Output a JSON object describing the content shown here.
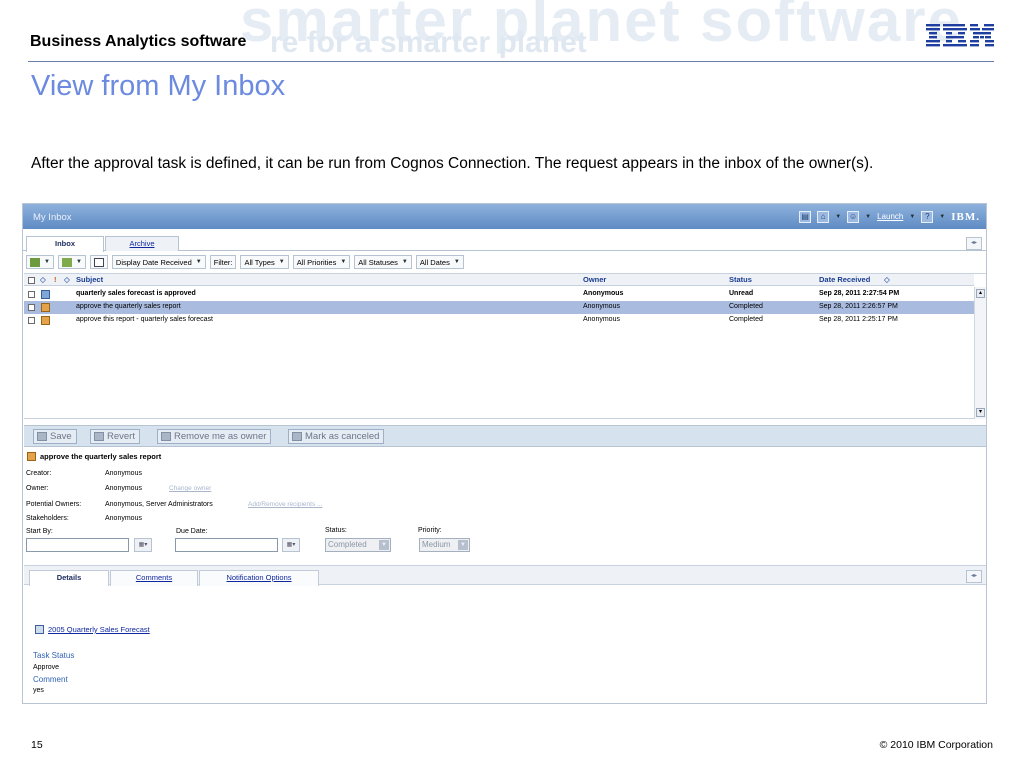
{
  "banner": {
    "brand_title": "Business Analytics software",
    "bg_watermark": "smarter planet software",
    "bg_watermark2": "re for a smarter planet",
    "logo_text": "IBM"
  },
  "slide": {
    "title": "View from My Inbox",
    "intro": "After the approval task is defined, it can be run from Cognos Connection.  The request appears in the inbox of the owner(s).",
    "page_number": "15",
    "copyright": "© 2010 IBM Corporation"
  },
  "app": {
    "title": "My Inbox",
    "topbar": {
      "launch_label": "Launch",
      "logo": "IBM."
    },
    "tabs": [
      {
        "label": "Inbox",
        "active": true
      },
      {
        "label": "Archive",
        "active": false
      }
    ],
    "toolbar": {
      "display_select": "Display Date Received",
      "filter_label": "Filter:",
      "types_select": "All Types",
      "priorities_select": "All Priorities",
      "statuses_select": "All Statuses",
      "dates_select": "All Dates"
    },
    "list": {
      "columns": {
        "subject": "Subject",
        "owner": "Owner",
        "status": "Status",
        "date": "Date Received"
      },
      "rows": [
        {
          "subject": "quarterly sales forecast is approved",
          "owner": "Anonymous",
          "status": "Unread",
          "date": "Sep 28, 2011 2:27:54 PM"
        },
        {
          "subject": "approve the quarterly sales report",
          "owner": "Anonymous",
          "status": "Completed",
          "date": "Sep 28, 2011 2:26:57 PM"
        },
        {
          "subject": "approve this report - quarterly sales forecast",
          "owner": "Anonymous",
          "status": "Completed",
          "date": "Sep 28, 2011 2:25:17 PM"
        }
      ]
    },
    "detail": {
      "buttons": {
        "save": "Save",
        "revert": "Revert",
        "remove_owner": "Remove me as owner",
        "mark_canceled": "Mark as canceled"
      },
      "task_title": "approve the quarterly sales report",
      "creator_label": "Creator:",
      "creator": "Anonymous",
      "owner_label": "Owner:",
      "owner": "Anonymous",
      "change_owner": "Change owner",
      "potential_owners_label": "Potential Owners:",
      "potential_owners": "Anonymous, Server Administrators",
      "add_remove": "Add/Remove recipients ...",
      "stakeholders_label": "Stakeholders:",
      "stakeholders": "Anonymous",
      "start_by_label": "Start By:",
      "due_date_label": "Due Date:",
      "status_label": "Status:",
      "status_value": "Completed",
      "priority_label": "Priority:",
      "priority_value": "Medium"
    },
    "tabs2": [
      {
        "label": "Details",
        "active": true
      },
      {
        "label": "Comments",
        "active": false
      },
      {
        "label": "Notification Options",
        "active": false
      }
    ],
    "report_link": "2005 Quarterly Sales Forecast",
    "task_status_label": "Task Status",
    "task_status_value": "Approve",
    "comment_label": "Comment",
    "comment_value": "yes"
  },
  "colors": {
    "title_blue": "#6b8ae0",
    "topbar_blue": "#5e8bc4",
    "selected_row": "#aabbe0",
    "link_blue": "#10289e"
  }
}
